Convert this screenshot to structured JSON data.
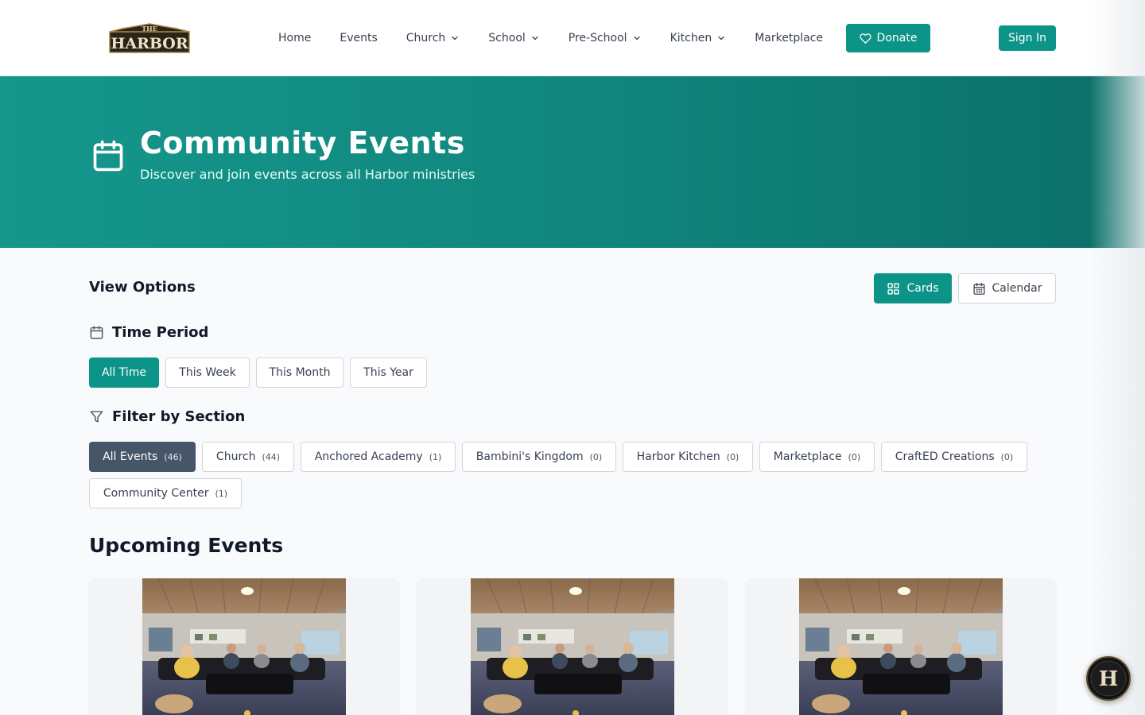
{
  "header": {
    "logo_top": "THE",
    "logo_main": "HARBOR",
    "nav": [
      {
        "label": "Home",
        "has_dropdown": false
      },
      {
        "label": "Events",
        "has_dropdown": false
      },
      {
        "label": "Church",
        "has_dropdown": true
      },
      {
        "label": "School",
        "has_dropdown": true
      },
      {
        "label": "Pre-School",
        "has_dropdown": true
      },
      {
        "label": "Kitchen",
        "has_dropdown": true
      },
      {
        "label": "Marketplace",
        "has_dropdown": false
      }
    ],
    "donate_label": "Donate",
    "signin_label": "Sign In"
  },
  "hero": {
    "icon": "calendar-icon",
    "title": "Community Events",
    "subtitle": "Discover and join events across all Harbor ministries"
  },
  "view_options": {
    "title": "View Options",
    "cards_label": "Cards",
    "calendar_label": "Calendar",
    "selected": "Cards"
  },
  "time_period": {
    "title": "Time Period",
    "options": [
      "All Time",
      "This Week",
      "This Month",
      "This Year"
    ],
    "selected": "All Time"
  },
  "filter": {
    "title": "Filter by Section",
    "sections": [
      {
        "label": "All Events",
        "count": "(46)"
      },
      {
        "label": "Church",
        "count": "(44)"
      },
      {
        "label": "Anchored Academy",
        "count": "(1)"
      },
      {
        "label": "Bambini's Kingdom",
        "count": "(0)"
      },
      {
        "label": "Harbor Kitchen",
        "count": "(0)"
      },
      {
        "label": "Marketplace",
        "count": "(0)"
      },
      {
        "label": "CraftED Creations",
        "count": "(0)"
      },
      {
        "label": "Community Center",
        "count": "(1)"
      }
    ],
    "selected": "All Events"
  },
  "upcoming": {
    "title": "Upcoming Events",
    "cards": 3
  },
  "colors": {
    "accent": "#0d9488",
    "active_filter": "#475569"
  },
  "float_badge_letter": "H"
}
